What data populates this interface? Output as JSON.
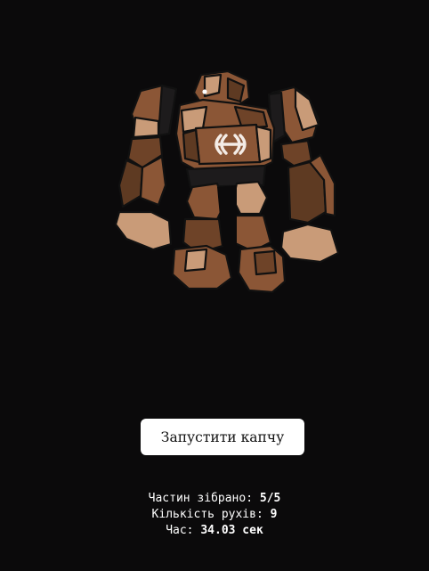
{
  "game": {
    "figure_icon": "stone-golem-puzzle-figure",
    "logo_icon": "double-c-logo-icon",
    "colors": {
      "background": "#0b0a0b",
      "light_stone": "#c99b78",
      "mid_stone": "#8b5636",
      "dark_stone": "#5e3a22",
      "outline": "#111111"
    }
  },
  "controls": {
    "start_button_label": "Запустити капчу"
  },
  "stats": {
    "parts_label": "Частин зібрано:",
    "parts_value": "5/5",
    "moves_label": "Кількість рухів:",
    "moves_value": "9",
    "time_label": "Час:",
    "time_value": "34.03 сек"
  }
}
